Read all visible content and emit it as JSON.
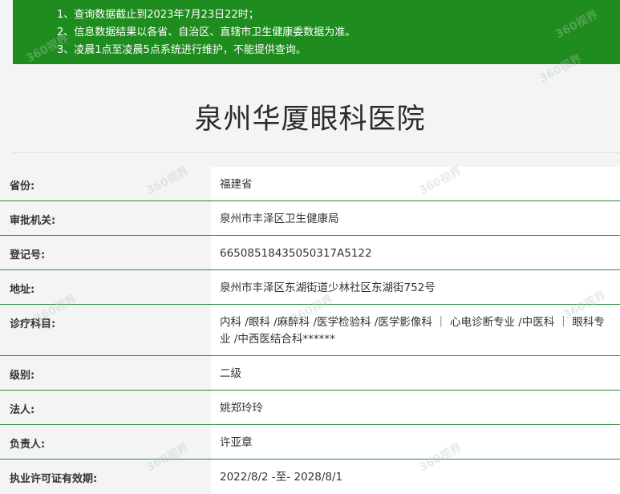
{
  "notice": {
    "lines": [
      "1、查询数据截止到2023年7月23日22时；",
      "2、信息数据结果以各省、自治区、直辖市卫生健康委数据为准。",
      "3、凌晨1点至凌晨5点系统进行维护，不能提供查询。"
    ]
  },
  "hospital": {
    "name": "泉州华厦眼科医院"
  },
  "rows": [
    {
      "label": "省份:",
      "value": "福建省"
    },
    {
      "label": "审批机关:",
      "value": "泉州市丰泽区卫生健康局"
    },
    {
      "label": "登记号:",
      "value": "66508518435050317A5122"
    },
    {
      "label": "地址:",
      "value": "泉州市丰泽区东湖街道少林社区东湖街752号"
    },
    {
      "label": "诊疗科目:",
      "value": "内科 /眼科 /麻醉科 /医学检验科 /医学影像科 ｜ 心电诊断专业 /中医科 ｜ 眼科专业 /中西医结合科******"
    },
    {
      "label": "级别:",
      "value": "二级"
    },
    {
      "label": "法人:",
      "value": "姚郑玲玲"
    },
    {
      "label": "负责人:",
      "value": "许亚章"
    },
    {
      "label": "执业许可证有效期:",
      "value": "2022/8/2 -至- 2028/8/1"
    }
  ],
  "watermark": {
    "text": "360视界"
  },
  "colors": {
    "notice_bg": "#1f8c1f",
    "row_border": "#2a8a3a",
    "page_bg": "#f4f4f4"
  }
}
